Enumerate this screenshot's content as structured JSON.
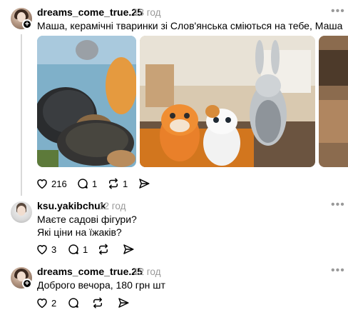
{
  "posts": [
    {
      "username": "dreams_come_true.25",
      "time": "13 год",
      "lines": [
        "Маша, керамічні тваринки зі Слов'янська сміються на тебе, Маша"
      ],
      "likes": "216",
      "replies": "1",
      "reposts": "1",
      "has_share_count": false
    },
    {
      "username": "ksu.yakibchuk",
      "time": "12 год",
      "lines": [
        "Маєте садові фігури?",
        "Які ціни на їжаків?"
      ],
      "likes": "3",
      "replies": "1"
    },
    {
      "username": "dreams_come_true.25",
      "time": "12 год",
      "lines": [
        "Доброго вечора, 180 грн шт"
      ],
      "likes": "2"
    }
  ],
  "icons": {
    "like": "heart-icon",
    "reply": "comment-icon",
    "repost": "repost-icon",
    "share": "send-icon",
    "more": "more-options-icon",
    "follow": "plus-icon"
  }
}
